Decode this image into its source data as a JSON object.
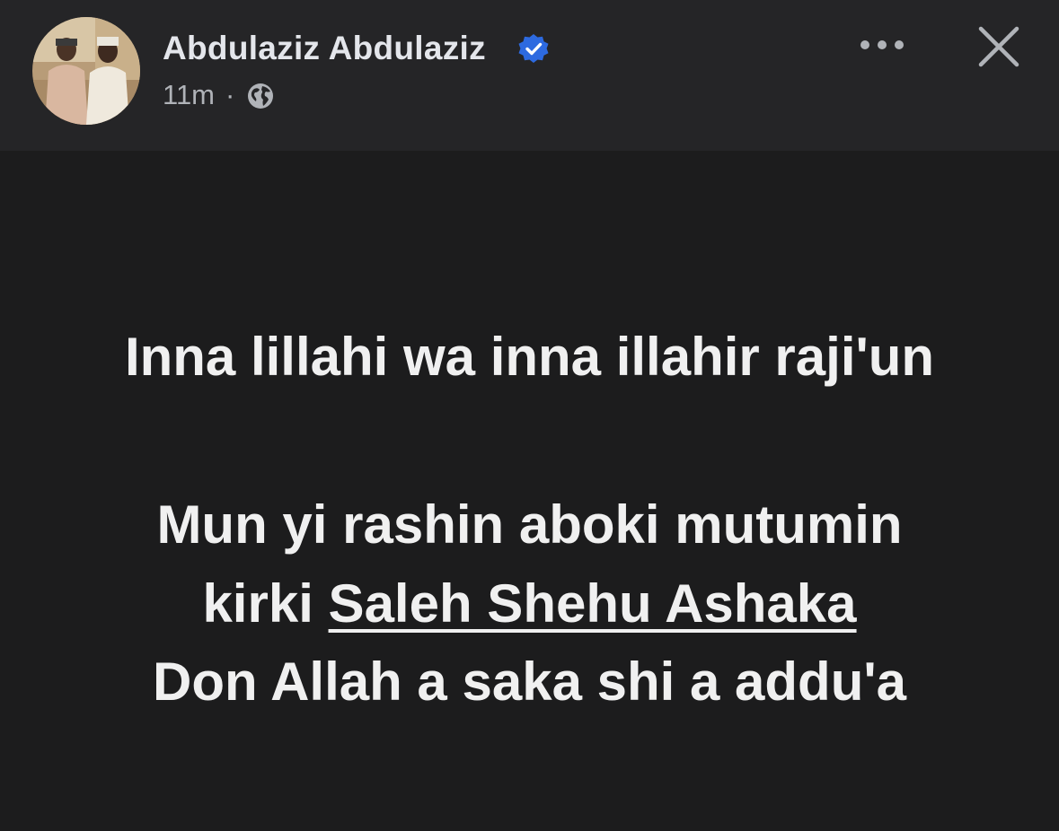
{
  "post": {
    "author": {
      "name": "Abdulaziz Abdulaziz",
      "verified": true,
      "avatar_icon": "profile-photo"
    },
    "timestamp": "11m",
    "separator": "·",
    "audience_icon": "globe-icon",
    "actions": {
      "more_icon": "ellipsis-icon",
      "close_icon": "close-icon"
    },
    "text": {
      "line1": "Inna lillahi wa inna illahir raji'un",
      "line2": "Mun yi rashin aboki mutumin",
      "line3_prefix": "kirki ",
      "line3_mention": "Saleh Shehu Ashaka",
      "line4": "Don Allah a saka shi a addu'a"
    }
  },
  "colors": {
    "header_bg": "#252527",
    "content_bg": "#1c1c1d",
    "text_primary": "#e4e6eb",
    "text_secondary": "#b0b3b8",
    "verified_blue": "#2d6ae0"
  }
}
